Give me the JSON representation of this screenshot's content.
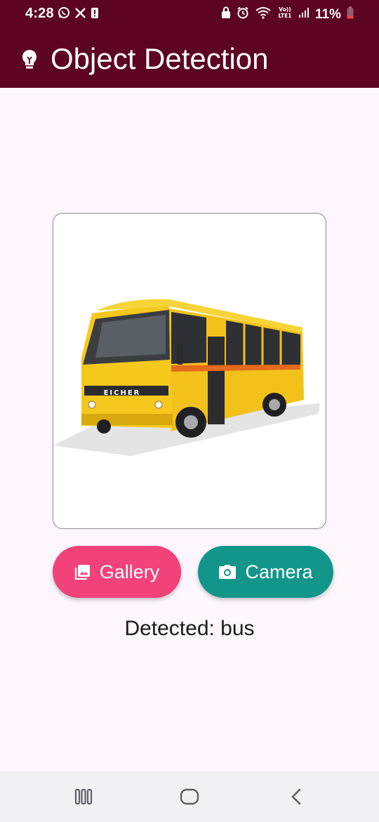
{
  "status_bar": {
    "time": "4:28",
    "battery_percent": "11%",
    "left_icons": [
      "whatsapp-icon",
      "x-icon",
      "alert-icon"
    ],
    "right_icons": [
      "lock-icon",
      "alarm-icon",
      "wifi-icon",
      "volte-icon",
      "signal-icon",
      "battery-icon"
    ]
  },
  "app_bar": {
    "title": "Object Detection",
    "icon": "lightbulb-icon",
    "background": "#5c0422"
  },
  "image_preview": {
    "subject": "yellow bus photo",
    "caption_on_vehicle": "EICHER"
  },
  "buttons": {
    "gallery_label": "Gallery",
    "gallery_icon": "gallery-icon",
    "gallery_color": "#f1427a",
    "camera_label": "Camera",
    "camera_icon": "camera-icon",
    "camera_color": "#12968a"
  },
  "result": {
    "text": "Detected: bus"
  },
  "nav_bar": {
    "items": [
      "recent-apps-icon",
      "home-icon",
      "back-icon"
    ]
  }
}
